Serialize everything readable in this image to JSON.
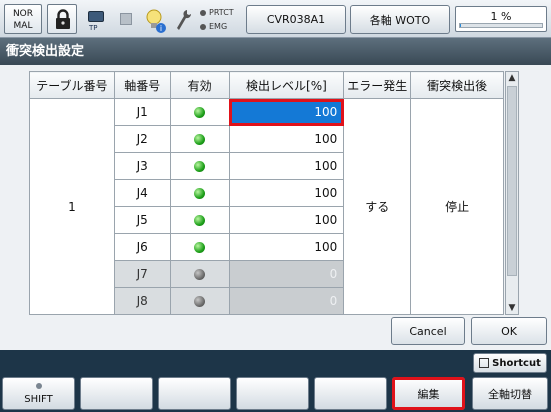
{
  "topbar": {
    "mode": "NOR\nMAL",
    "mode_l1": "NOR",
    "mode_l2": "MAL",
    "tp_label": "TP",
    "prtct_label": "PRTCT",
    "emg_label": "EMG",
    "program_name": "CVR038A1",
    "axis_mode": "各軸 WOTO",
    "progress_pct_label": "1 %",
    "progress_value": 1
  },
  "title": "衝突検出設定",
  "table": {
    "headers": [
      "テーブル番号",
      "軸番号",
      "有効",
      "検出レベル[%]",
      "エラー発生",
      "衝突検出後"
    ],
    "table_number": "1",
    "error_occurrence": "する",
    "after_detection": "停止",
    "rows": [
      {
        "axis": "J1",
        "enabled": true,
        "level": "100"
      },
      {
        "axis": "J2",
        "enabled": true,
        "level": "100"
      },
      {
        "axis": "J3",
        "enabled": true,
        "level": "100"
      },
      {
        "axis": "J4",
        "enabled": true,
        "level": "100"
      },
      {
        "axis": "J5",
        "enabled": true,
        "level": "100"
      },
      {
        "axis": "J6",
        "enabled": true,
        "level": "100"
      },
      {
        "axis": "J7",
        "enabled": false,
        "level": "0"
      },
      {
        "axis": "J8",
        "enabled": false,
        "level": "0"
      }
    ]
  },
  "buttons": {
    "cancel": "Cancel",
    "ok": "OK",
    "shortcut": "Shortcut"
  },
  "function_keys": {
    "shift": "SHIFT",
    "edit": "編集",
    "all_axis_switch": "全軸切替"
  },
  "colors": {
    "selected_cell": "#1479d6",
    "highlight_outline": "#e0121a",
    "enabled_led": "#1ea01a",
    "disabled_led": "#6d6d6d"
  }
}
